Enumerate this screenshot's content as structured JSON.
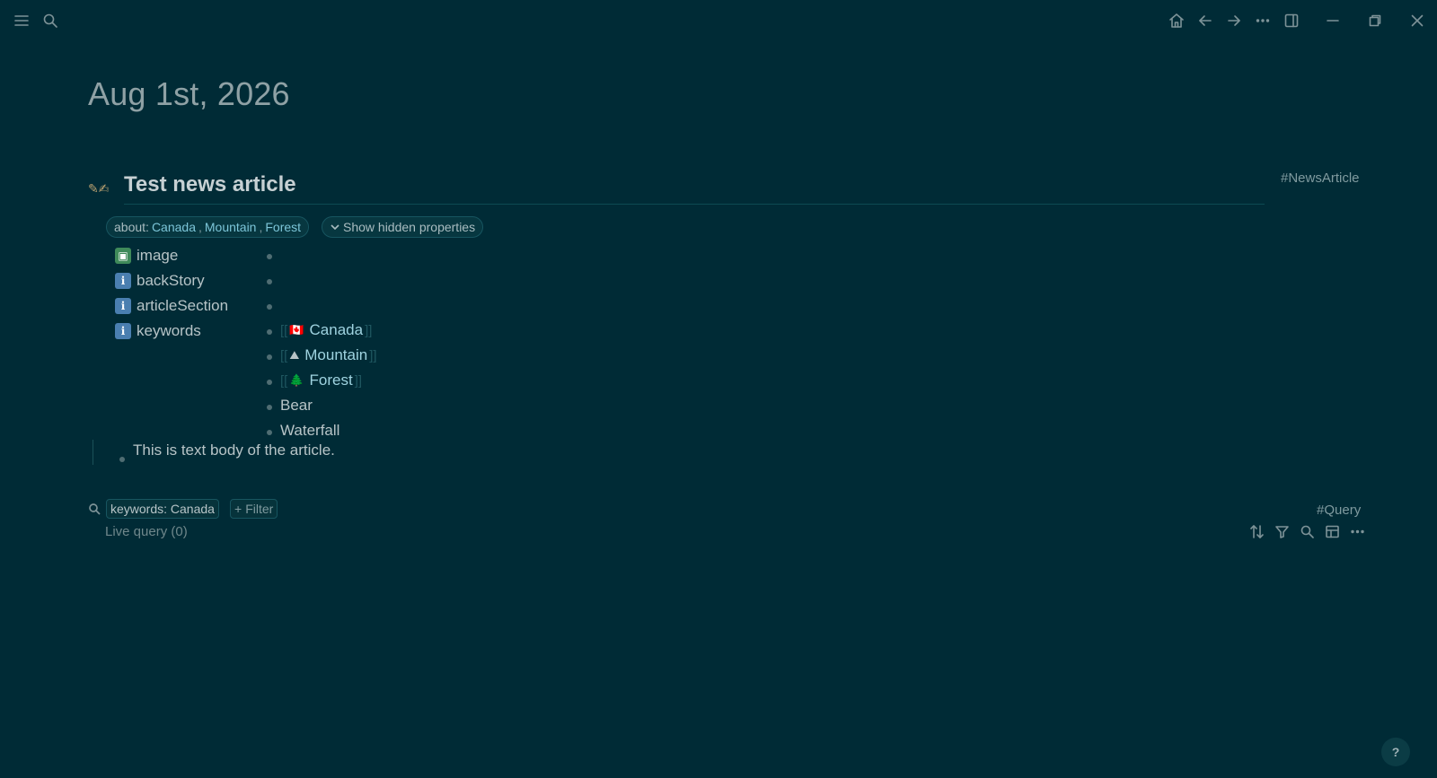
{
  "page": {
    "title": "Aug 1st, 2026"
  },
  "block": {
    "icon": "✎✍",
    "title": "Test news article",
    "tag": "#NewsArticle"
  },
  "properties_pill": {
    "label": "about:",
    "links": [
      "Canada",
      "Mountain",
      "Forest"
    ],
    "separator": ","
  },
  "show_hidden": {
    "label": "Show hidden properties"
  },
  "properties": [
    {
      "key": "image",
      "icon": "image-icon"
    },
    {
      "key": "backStory",
      "icon": "info-icon"
    },
    {
      "key": "articleSection",
      "icon": "info-icon"
    },
    {
      "key": "keywords",
      "icon": "info-icon"
    }
  ],
  "keyword_values": [
    {
      "text": "Canada",
      "emoji": "🇨🇦",
      "linked": true
    },
    {
      "text": "Mountain",
      "emoji": "⛰",
      "linked": true
    },
    {
      "text": "Forest",
      "emoji": "🌲",
      "linked": true
    },
    {
      "text": "Bear",
      "linked": false
    },
    {
      "text": "Waterfall",
      "linked": false
    }
  ],
  "brackets": {
    "open": "[[",
    "close": "]]"
  },
  "body": {
    "text": "This is text body of the article."
  },
  "query": {
    "filter": "keywords: Canada",
    "add_filter": "Filter",
    "add_symbol": "+",
    "tag": "#Query",
    "status": "Live query (0)"
  },
  "help": {
    "label": "?"
  },
  "colors": {
    "background": "#002b36",
    "link": "#9fd3e0",
    "accent": "#7cc5d8"
  }
}
